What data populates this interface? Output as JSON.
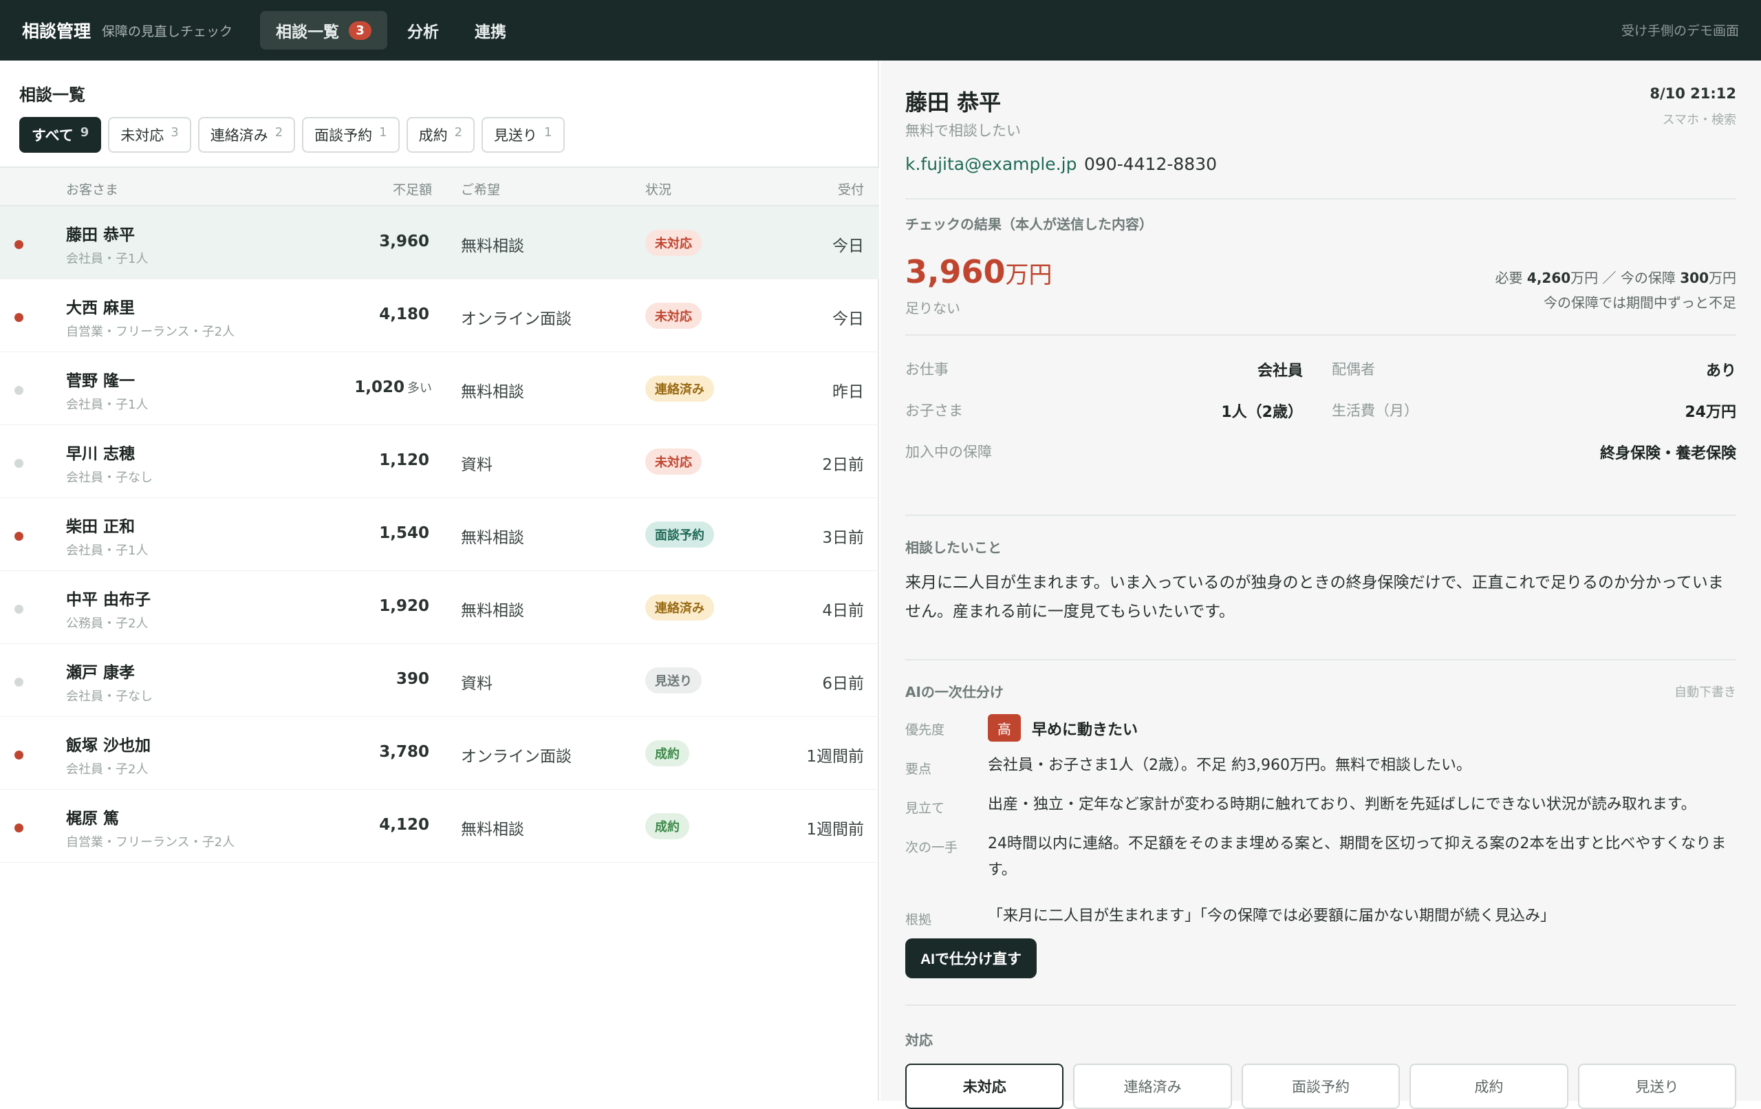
{
  "app": {
    "title": "相談管理",
    "subtitle": "保障の見直しチェック",
    "nav": [
      {
        "label": "相談一覧",
        "badge": "3",
        "active": true
      },
      {
        "label": "分析"
      },
      {
        "label": "連携"
      }
    ],
    "demo_note": "受け手側のデモ画面"
  },
  "list": {
    "title": "相談一覧",
    "filters": [
      {
        "label": "すべて",
        "count": "9",
        "active": true
      },
      {
        "label": "未対応",
        "count": "3"
      },
      {
        "label": "連絡済み",
        "count": "2"
      },
      {
        "label": "面談予約",
        "count": "1"
      },
      {
        "label": "成約",
        "count": "2"
      },
      {
        "label": "見送り",
        "count": "1"
      }
    ],
    "columns": {
      "customer": "お客さま",
      "shortfall": "不足額",
      "wish": "ご希望",
      "status": "状況",
      "received": "受付"
    },
    "rows": [
      {
        "name": "藤田 恭平",
        "meta": "会社員・子1人",
        "amount": "3,960",
        "over": "",
        "wish": "無料相談",
        "status": "未対応",
        "received": "今日",
        "unread": true
      },
      {
        "name": "大西 麻里",
        "meta": "自営業・フリーランス・子2人",
        "amount": "4,180",
        "over": "",
        "wish": "オンライン面談",
        "status": "未対応",
        "received": "今日",
        "unread": true
      },
      {
        "name": "菅野 隆一",
        "meta": "会社員・子1人",
        "amount": "1,020",
        "over": "多い",
        "wish": "無料相談",
        "status": "連絡済み",
        "received": "昨日",
        "unread": false
      },
      {
        "name": "早川 志穂",
        "meta": "会社員・子なし",
        "amount": "1,120",
        "over": "",
        "wish": "資料",
        "status": "未対応",
        "received": "2日前",
        "unread": false
      },
      {
        "name": "柴田 正和",
        "meta": "会社員・子1人",
        "amount": "1,540",
        "over": "",
        "wish": "無料相談",
        "status": "面談予約",
        "received": "3日前",
        "unread": true
      },
      {
        "name": "中平 由布子",
        "meta": "公務員・子2人",
        "amount": "1,920",
        "over": "",
        "wish": "無料相談",
        "status": "連絡済み",
        "received": "4日前",
        "unread": false
      },
      {
        "name": "瀬戸 康孝",
        "meta": "会社員・子なし",
        "amount": "390",
        "over": "",
        "wish": "資料",
        "status": "見送り",
        "received": "6日前",
        "unread": false
      },
      {
        "name": "飯塚 沙也加",
        "meta": "会社員・子2人",
        "amount": "3,780",
        "over": "",
        "wish": "オンライン面談",
        "status": "成約",
        "received": "1週間前",
        "unread": true
      },
      {
        "name": "梶原 篤",
        "meta": "自営業・フリーランス・子2人",
        "amount": "4,120",
        "over": "",
        "wish": "無料相談",
        "status": "成約",
        "received": "1週間前",
        "unread": true
      }
    ]
  },
  "status_colors": {
    "未対応": {
      "bg": "#fbe3de",
      "fg": "#c0452f"
    },
    "連絡済み": {
      "bg": "#fbeccd",
      "fg": "#9a6a12"
    },
    "面談予約": {
      "bg": "#d5ebe6",
      "fg": "#1f6a56"
    },
    "成約": {
      "bg": "#e2f1e3",
      "fg": "#3d8a4b"
    },
    "見送り": {
      "bg": "#eceeed",
      "fg": "#6e7a78"
    }
  },
  "unread_color": "#c0452f",
  "read_color": "#d3d9d7",
  "detail": {
    "name": "藤田 恭平",
    "request": "無料で相談したい",
    "date": "8/10 21:12",
    "source": "スマホ・検索",
    "email": "k.fujita@example.jp",
    "phone": "090-4412-8830",
    "result_label": "チェックの結果（本人が送信した内容）",
    "shortfall_value": "3,960",
    "shortfall_unit": "万円",
    "shortfall_note": "足りない",
    "need_prefix": "必要",
    "need_value": "4,260",
    "need_unit": "万円",
    "sep": "／",
    "current_prefix": "今の保障",
    "current_value": "300",
    "current_unit": "万円",
    "coverage_note": "今の保障では期間中ずっと不足",
    "profile": {
      "job_label": "お仕事",
      "job": "会社員",
      "spouse_label": "配偶者",
      "spouse": "あり",
      "kids_label": "お子さま",
      "kids": "1人（2歳）",
      "living_label": "生活費（月）",
      "living": "24万円",
      "policies_label": "加入中の保障",
      "policies": "終身保険・養老保険"
    },
    "consult_label": "相談したいこと",
    "consult_text": "来月に二人目が生まれます。いま入っているのが独身のときの終身保険だけで、正直これで足りるのか分かっていません。産まれる前に一度見てもらいたいです。",
    "ai": {
      "title": "AIの一次仕分け",
      "auto": "自動下書き",
      "priority_label": "優先度",
      "priority_badge": "高",
      "priority_text": "早めに動きたい",
      "summary_label": "要点",
      "summary": "会社員・お子さま1人（2歳）。不足 約3,960万円。無料で相談したい。",
      "outlook_label": "見立て",
      "outlook": "出産・独立・定年など家計が変わる時期に触れており、判断を先延ばしにできない状況が読み取れます。",
      "next_label": "次の一手",
      "next": "24時間以内に連絡。不足額をそのまま埋める案と、期間を区切って抑える案の2本を出すと比べやすくなります。",
      "basis_label": "根拠",
      "basis": "「来月に二人目が生まれます」「今の保障では必要額に届かない期間が続く見込み」",
      "button": "AIで仕分け直す"
    },
    "action_label": "対応",
    "actions": [
      "未対応",
      "連絡済み",
      "面談予約",
      "成約",
      "見送り"
    ],
    "active_action": "未対応"
  }
}
